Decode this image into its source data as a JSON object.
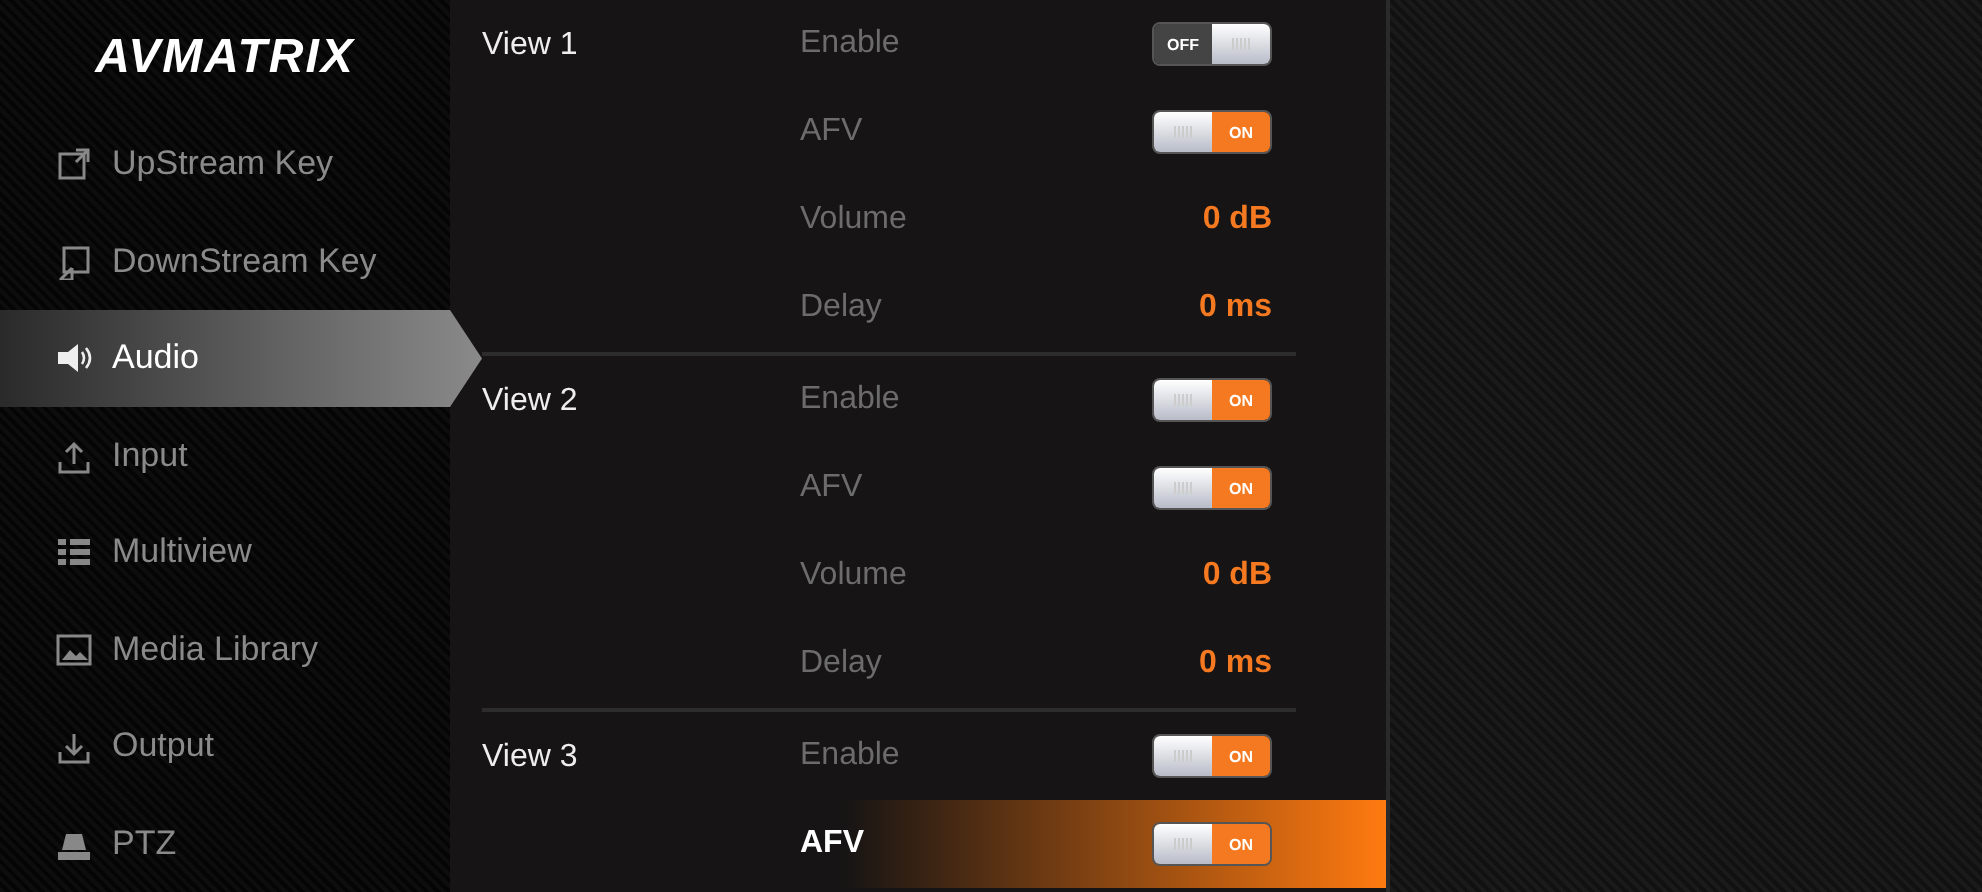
{
  "logo": "AVMATRIX",
  "sidebar": {
    "items": [
      {
        "label": "UpStream Key",
        "selected": false
      },
      {
        "label": "DownStream Key",
        "selected": false
      },
      {
        "label": "Audio",
        "selected": true
      },
      {
        "label": "Input",
        "selected": false
      },
      {
        "label": "Multiview",
        "selected": false
      },
      {
        "label": "Media Library",
        "selected": false
      },
      {
        "label": "Output",
        "selected": false
      },
      {
        "label": "PTZ",
        "selected": false
      }
    ]
  },
  "views": [
    {
      "title": "View 1",
      "rows": [
        {
          "kind": "toggle",
          "label": "Enable",
          "on": false,
          "toggle_text": "OFF",
          "selected": false
        },
        {
          "kind": "toggle",
          "label": "AFV",
          "on": true,
          "toggle_text": "ON",
          "selected": false
        },
        {
          "kind": "value",
          "label": "Volume",
          "value": "0 dB",
          "selected": false
        },
        {
          "kind": "value",
          "label": "Delay",
          "value": "0 ms",
          "selected": false
        }
      ]
    },
    {
      "title": "View 2",
      "rows": [
        {
          "kind": "toggle",
          "label": "Enable",
          "on": true,
          "toggle_text": "ON",
          "selected": false
        },
        {
          "kind": "toggle",
          "label": "AFV",
          "on": true,
          "toggle_text": "ON",
          "selected": false
        },
        {
          "kind": "value",
          "label": "Volume",
          "value": "0 dB",
          "selected": false
        },
        {
          "kind": "value",
          "label": "Delay",
          "value": "0 ms",
          "selected": false
        }
      ]
    },
    {
      "title": "View 3",
      "rows": [
        {
          "kind": "toggle",
          "label": "Enable",
          "on": true,
          "toggle_text": "ON",
          "selected": false
        },
        {
          "kind": "toggle",
          "label": "AFV",
          "on": true,
          "toggle_text": "ON",
          "selected": true
        }
      ]
    }
  ]
}
